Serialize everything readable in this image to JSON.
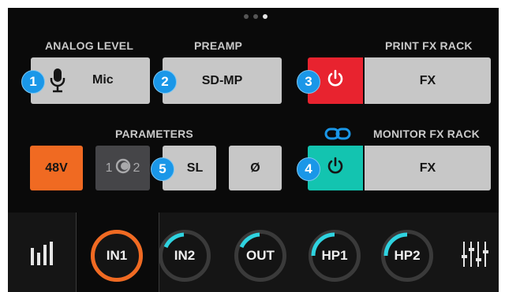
{
  "pager": {
    "count": 3,
    "active": 3
  },
  "analog": {
    "header": "ANALOG LEVEL",
    "value": "Mic",
    "badge": "1",
    "icon": "microphone-icon"
  },
  "preamp": {
    "header": "PREAMP",
    "value": "SD-MP",
    "badge": "2"
  },
  "print_fx": {
    "header": "PRINT FX RACK",
    "fx_label": "FX",
    "badge": "3",
    "power_color": "#e8232f"
  },
  "parameters": {
    "header": "PARAMETERS",
    "phantom": "48V",
    "phantom_color": "#f06a22",
    "polarity_left": "1",
    "polarity_right": "2",
    "sl": "SL",
    "phase": "Ø",
    "badge": "5"
  },
  "monitor_fx": {
    "header": "MONITOR FX RACK",
    "fx_label": "FX",
    "badge": "4",
    "power_color": "#13c4b0",
    "link_icon": "link-icon"
  },
  "tabs": [
    {
      "label": "IN1",
      "active": true,
      "ring_color": "#f06a22"
    },
    {
      "label": "IN2",
      "active": false,
      "ring_color": "#2fd3e0"
    },
    {
      "label": "OUT",
      "active": false,
      "ring_color": "#2fd3e0"
    },
    {
      "label": "HP1",
      "active": false,
      "ring_color": "#2fd3e0"
    },
    {
      "label": "HP2",
      "active": false,
      "ring_color": "#2fd3e0"
    }
  ],
  "icons": {
    "meters": "level-meters-icon",
    "mixer": "mixer-faders-icon"
  }
}
